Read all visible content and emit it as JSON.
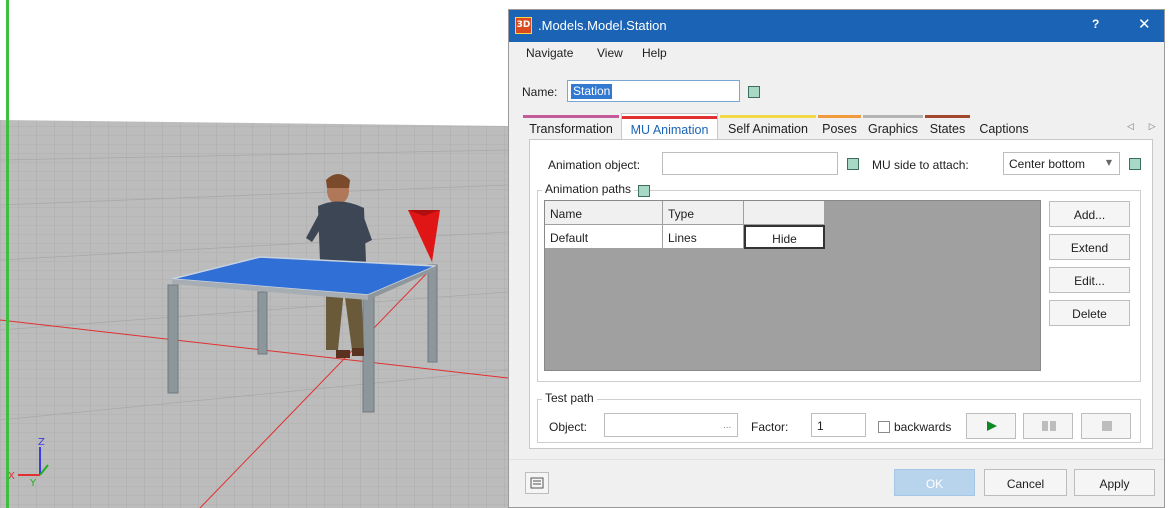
{
  "viewport": {
    "axes": {
      "z": "Z",
      "x": "X",
      "y": "Y"
    },
    "colors": {
      "sky": "#ffffff",
      "floor": "#bcbcbc",
      "grid_line": "#9e9e9e",
      "axis_red": "#e03030",
      "table_top": "#2f6fd6",
      "table_leg": "#8a9296",
      "cone": "#e01616"
    }
  },
  "dialog": {
    "app_icon": "3D",
    "title": ".Models.Model.Station",
    "help_icon": "?",
    "close_icon": "✕",
    "menu": [
      "Navigate",
      "View",
      "Help"
    ],
    "name_label": "Name:",
    "name_value": "Station",
    "tabs": [
      {
        "label": "Transformation",
        "color": "#c35b9a"
      },
      {
        "label": "MU Animation",
        "color": "#e03030",
        "active": true
      },
      {
        "label": "Self Animation",
        "color": "#f1d94a"
      },
      {
        "label": "Poses",
        "color": "#f09a3c"
      },
      {
        "label": "Graphics",
        "color": "#b4b4b4"
      },
      {
        "label": "States",
        "color": "#a3472d"
      },
      {
        "label": "Captions",
        "color": ""
      }
    ],
    "tab_scroll_icons": "◁ ▷",
    "animation_object_label": "Animation object:",
    "animation_object_value": "",
    "mu_side_label": "MU side to attach:",
    "mu_side_value": "Center bottom",
    "animation_paths_label": "Animation paths",
    "paths_table": {
      "columns": [
        "Name",
        "Type",
        ""
      ],
      "rows": [
        {
          "name": "Default",
          "type": "Lines",
          "action": "Hide"
        }
      ]
    },
    "side_buttons": [
      "Add...",
      "Extend",
      "Edit...",
      "Delete"
    ],
    "test_path_label": "Test path",
    "object_label": "Object:",
    "object_value": "",
    "object_browse": "...",
    "factor_label": "Factor:",
    "factor_value": "1",
    "backwards_label": "backwards",
    "play_icon": "play-icon",
    "footer": {
      "ok": "OK",
      "cancel": "Cancel",
      "apply": "Apply"
    }
  }
}
